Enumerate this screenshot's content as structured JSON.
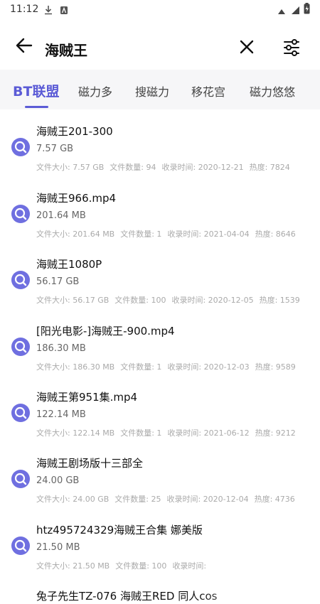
{
  "status": {
    "time": "11:12"
  },
  "header": {
    "query": "海贼王"
  },
  "tabs": [
    {
      "label": "BT联盟",
      "active": true
    },
    {
      "label": "磁力多"
    },
    {
      "label": "搜磁力"
    },
    {
      "label": "移花宫"
    },
    {
      "label": "磁力悠悠"
    }
  ],
  "results": [
    {
      "title": "海贼王201-300",
      "size": "7.57 GB",
      "meta": {
        "filesize": "文件大小: 7.57 GB",
        "count": "文件数量: 94",
        "date": "收录时间: 2020-12-21",
        "heat": "热度: 7824"
      }
    },
    {
      "title": "海贼王966.mp4",
      "size": "201.64 MB",
      "meta": {
        "filesize": "文件大小: 201.64 MB",
        "count": "文件数量: 1",
        "date": "收录时间: 2021-04-04",
        "heat": "热度: 8646"
      }
    },
    {
      "title": "海贼王1080P",
      "size": "56.17 GB",
      "meta": {
        "filesize": "文件大小: 56.17 GB",
        "count": "文件数量: 100",
        "date": "收录时间: 2020-12-05",
        "heat": "热度: 1539"
      }
    },
    {
      "title": "[阳光电影-]海贼王-900.mp4",
      "size": "186.30 MB",
      "meta": {
        "filesize": "文件大小: 186.30 MB",
        "count": "文件数量: 1",
        "date": "收录时间: 2020-12-03",
        "heat": "热度: 9589"
      }
    },
    {
      "title": "海贼王第951集.mp4",
      "size": "122.14 MB",
      "meta": {
        "filesize": "文件大小: 122.14 MB",
        "count": "文件数量: 1",
        "date": "收录时间: 2021-06-12",
        "heat": "热度: 9212"
      }
    },
    {
      "title": "海贼王剧场版十三部全",
      "size": "24.00 GB",
      "meta": {
        "filesize": "文件大小: 24.00 GB",
        "count": "文件数量: 25",
        "date": "收录时间: 2020-12-04",
        "heat": "热度: 4736"
      }
    },
    {
      "title": "htz495724329海贼王合集 娜美版",
      "size": "21.50 MB",
      "meta": {
        "filesize": "文件大小: 21.50 MB",
        "count": "文件数量: 100",
        "date": "收录时间:",
        "heat": ""
      }
    },
    {
      "title": "兔子先生TZ-076 海贼王RED 同人cos",
      "size": "",
      "meta": {
        "filesize": "",
        "count": "",
        "date": "",
        "heat": ""
      }
    }
  ]
}
